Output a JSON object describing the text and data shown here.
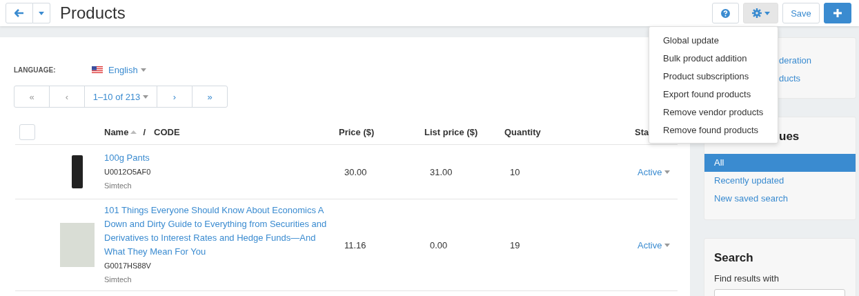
{
  "toolbar": {
    "title": "Products",
    "save_label": "Save"
  },
  "settings_menu": {
    "expanded": true,
    "items": [
      "Global update",
      "Bulk product addition",
      "Product subscriptions",
      "Export found products",
      "Remove vendor products",
      "Remove found products"
    ]
  },
  "language": {
    "label": "LANGUAGE:",
    "value": "English"
  },
  "pagination": {
    "first": "«",
    "prev": "‹",
    "range": "1–10 of 213",
    "next": "›",
    "last": "»"
  },
  "table": {
    "select_all_checked": false,
    "header": {
      "name": "Name",
      "separator": "/",
      "code": "CODE",
      "price": "Price ($)",
      "list_price": "List price ($)",
      "quantity": "Quantity",
      "status": "Sta"
    },
    "rows": [
      {
        "name": "100g Pants",
        "code": "U0012O5AF0",
        "vendor": "Simtech",
        "price": "30.00",
        "list_price": "31.00",
        "quantity": "10",
        "status": "Active"
      },
      {
        "name": "101 Things Everyone Should Know About Economics A Down and Dirty Guide to Everything from Securities and Derivatives to Interest Rates and Hedge Funds—And What They Mean For You",
        "code": "G0017HS88V",
        "vendor": "Simtech",
        "price": "11.16",
        "list_price": "0.00",
        "quantity": "19",
        "status": "Active"
      }
    ]
  },
  "sidebar": {
    "links": [
      "deration",
      "ducts"
    ],
    "saved_searches": {
      "title": "ues",
      "items": [
        {
          "label": "All",
          "selected": true
        },
        {
          "label": "Recently updated",
          "selected": false
        },
        {
          "label": "New saved search",
          "selected": false
        }
      ]
    },
    "search": {
      "title": "Search",
      "label": "Find results with"
    }
  }
}
